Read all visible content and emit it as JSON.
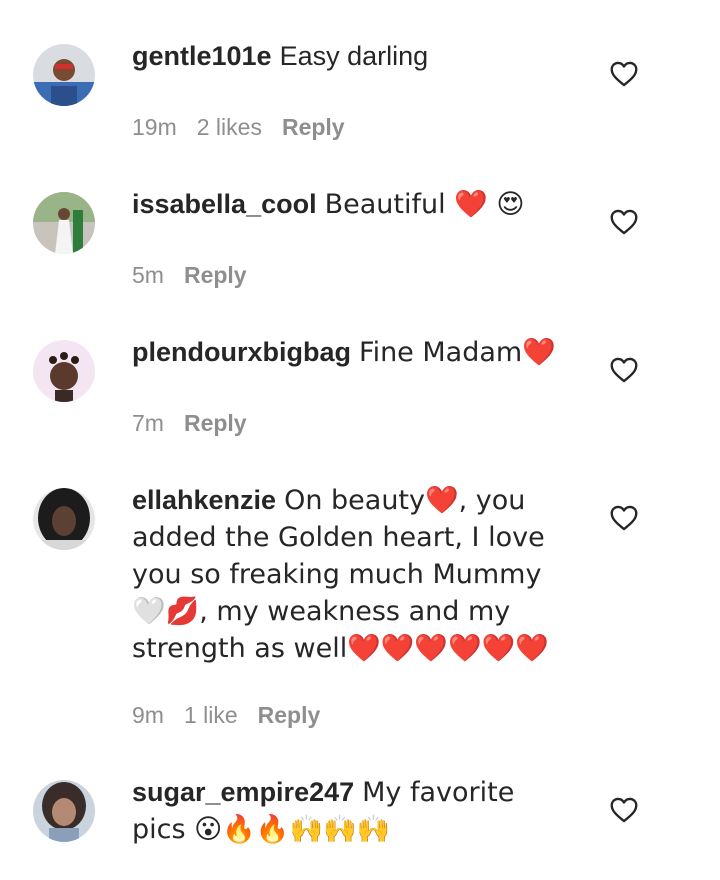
{
  "comments": [
    {
      "username": "gentle101e",
      "text": "Easy darling",
      "time": "19m",
      "likes": "2 likes",
      "reply": "Reply"
    },
    {
      "username": "issabella_cool",
      "text": "Beautiful ❤️ 😍",
      "time": "5m",
      "reply": "Reply"
    },
    {
      "username": "plendourxbigbag",
      "text": "Fine Madam❤️",
      "time": "7m",
      "reply": "Reply"
    },
    {
      "username": "ellahkenzie",
      "text": "On beauty❤️, you added the Golden heart, I love you so freaking much Mummy 🤍💋, my weakness and my strength as well❤️❤️❤️❤️❤️❤️",
      "time": "9m",
      "likes": "1 like",
      "reply": "Reply"
    },
    {
      "username": "sugar_empire247",
      "text": "My favorite pics 😮🔥🔥🙌🙌🙌"
    }
  ],
  "icons": {
    "like": "heart-outline-icon"
  }
}
